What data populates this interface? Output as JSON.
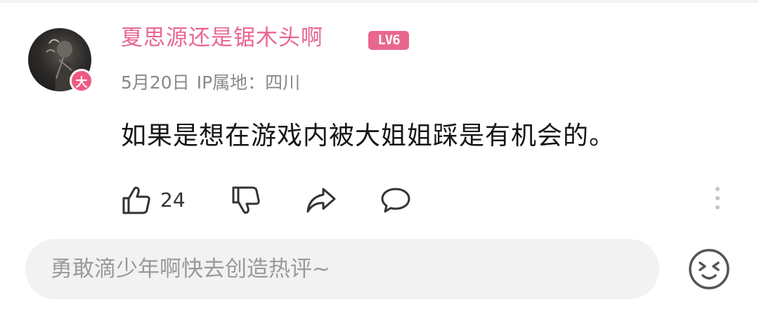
{
  "comment": {
    "avatar_badge": "大",
    "username": "夏思源还是锯木头啊",
    "level_badge": "LV6",
    "date": "5月20日",
    "ip_location": "IP属地：四川",
    "text": "如果是想在游戏内被大姐姐踩是有机会的。",
    "actions": {
      "like_icon": "thumbs-up-icon",
      "like_count": "24",
      "dislike_icon": "thumbs-down-icon",
      "share_icon": "share-icon",
      "reply_icon": "comment-icon",
      "more_icon": "more-vertical-icon"
    }
  },
  "reply_bar": {
    "placeholder": "勇敢滴少年啊快去创造热评~",
    "emoji_icon": "emoji-icon"
  },
  "colors": {
    "accent_pink": "#e8678f",
    "badge_pink": "#ee5a82",
    "meta_gray": "#888888",
    "input_bg": "#f2f2f2"
  }
}
